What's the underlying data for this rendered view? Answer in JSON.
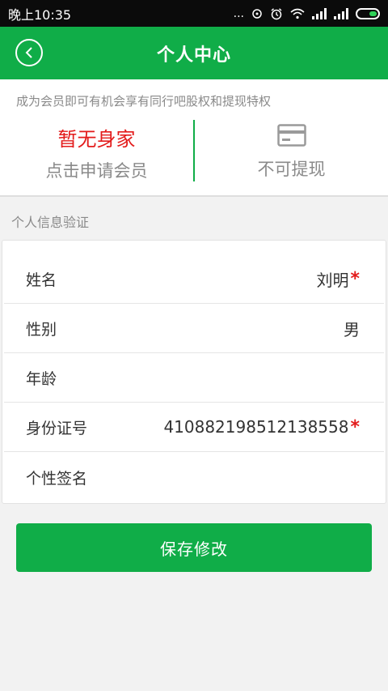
{
  "status_bar": {
    "time": "晚上10:35",
    "dots": "..."
  },
  "header": {
    "title": "个人中心"
  },
  "member": {
    "tip": "成为会员即可有机会享有同行吧股权和提现特权",
    "status": "暂无身家",
    "apply": "点击申请会员",
    "withdraw": "不可提现"
  },
  "section": {
    "title": "个人信息验证"
  },
  "info": {
    "rows": [
      {
        "label": "姓名",
        "value": "刘明",
        "required": "*"
      },
      {
        "label": "性别",
        "value": "男",
        "required": ""
      },
      {
        "label": "年龄",
        "value": "",
        "required": ""
      },
      {
        "label": "身份证号",
        "value": "410882198512138558",
        "required": "*"
      },
      {
        "label": "个性签名",
        "value": "",
        "required": ""
      }
    ]
  },
  "actions": {
    "save": "保存修改"
  },
  "colors": {
    "primary": "#10ad48",
    "accent_red": "#e31b1b",
    "muted_text": "#8a8a8a"
  }
}
